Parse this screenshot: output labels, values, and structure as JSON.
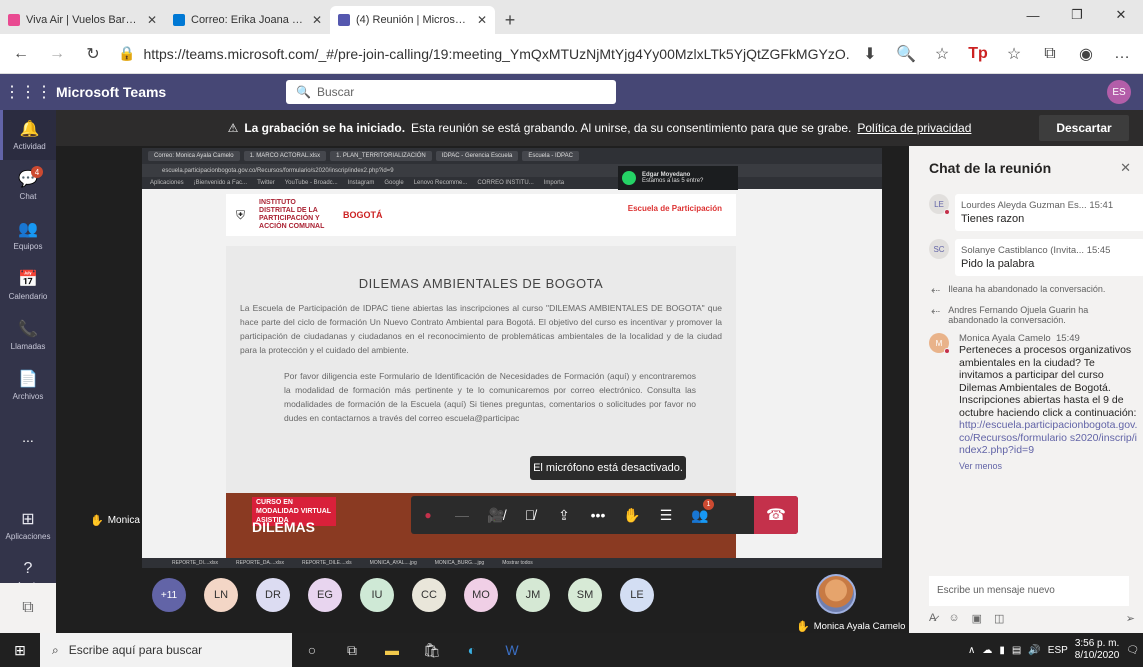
{
  "browser": {
    "tabs": [
      {
        "title": "Viva Air | Vuelos Baratos a Destin",
        "fav": "#e94a91",
        "active": false
      },
      {
        "title": "Correo: Erika Joana Velez Saldarr",
        "fav": "#0078d4",
        "active": false
      },
      {
        "title": "(4) Reunión | Microsoft Tear",
        "fav": "#5558af",
        "active": true
      }
    ],
    "url": "https://teams.microsoft.com/_#/pre-join-calling/19:meeting_YmQxMTUzNjMtYjg4Yy00MzlxLTk5YjQtZGFkMGYzO..."
  },
  "teams": {
    "app_name": "Microsoft Teams",
    "search_placeholder": "Buscar",
    "user_initials": "ES",
    "rail": [
      {
        "label": "Actividad",
        "icon": "bell-icon",
        "glyph": "🔔",
        "badge": ""
      },
      {
        "label": "Chat",
        "icon": "chat-icon",
        "glyph": "💬",
        "badge": "4"
      },
      {
        "label": "Equipos",
        "icon": "teams-icon",
        "glyph": "👥",
        "badge": ""
      },
      {
        "label": "Calendario",
        "icon": "calendar-icon",
        "glyph": "📅",
        "badge": ""
      },
      {
        "label": "Llamadas",
        "icon": "phone-icon",
        "glyph": "📞",
        "badge": ""
      },
      {
        "label": "Archivos",
        "icon": "files-icon",
        "glyph": "📄",
        "badge": ""
      },
      {
        "label": "...",
        "icon": "more-icon",
        "glyph": "",
        "badge": ""
      }
    ],
    "rail_bottom": [
      {
        "label": "Aplicaciones",
        "icon": "apps-icon",
        "glyph": "⊞"
      },
      {
        "label": "Ayuda",
        "icon": "help-icon",
        "glyph": "?"
      }
    ]
  },
  "meeting": {
    "banner_bold": "La grabación se ha iniciado.",
    "banner_text": "Esta reunión se está grabando. Al unirse, da su consentimiento para que se grabe.",
    "banner_link": "Política de privacidad",
    "dismiss": "Descartar",
    "tooltip": "El micrófono está desactivado.",
    "speaker_name": "Monica Ayala Camelo",
    "self_name": "Monica Ayala Camelo",
    "participant_count_badge": "1",
    "participants": [
      {
        "initials": "+11",
        "color": "#6264a7"
      },
      {
        "initials": "LN",
        "color": "#f3d6c6"
      },
      {
        "initials": "DR",
        "color": "#dcdcf2"
      },
      {
        "initials": "EG",
        "color": "#e8d5ef"
      },
      {
        "initials": "IU",
        "color": "#cfe9d6"
      },
      {
        "initials": "CC",
        "color": "#e9e6da"
      },
      {
        "initials": "MO",
        "color": "#f0cfe6"
      },
      {
        "initials": "JM",
        "color": "#d5e8d4"
      },
      {
        "initials": "SM",
        "color": "#d7ead6"
      },
      {
        "initials": "LE",
        "color": "#d3def3"
      }
    ]
  },
  "shared_screen": {
    "tabs": [
      "Correo: Monica Ayala Camelo",
      "1. MARCO ACTORAL.xlsx",
      "1. PLAN_TERRITORIALIZACIÓN",
      "IDPAC - Gerencia Escuela",
      "Escuela - IDPAC"
    ],
    "address": "escuela.participacionbogota.gov.co/Recursos/formulario/s2020/inscrip/index2.php?id=9",
    "bookmarks": [
      "Aplicaciones",
      "¡Bienvenido a Fac...",
      "Twitter",
      "YouTube - Broadc...",
      "Instagram",
      "Google",
      "Lenovo Recomme...",
      "CORREO INSTITU...",
      "Importa"
    ],
    "whatsapp_name": "Edgar Moyedano",
    "whatsapp_msg": "Estamos a las 5 entre?",
    "logo_left": "INSTITUTO DISTRITAL DE LA PARTICIPACIÓN Y ACCIÓN COMUNAL",
    "logo_bogota": "BOGOTÁ",
    "logo_right": "Escuela de Participación",
    "title": "DILEMAS AMBIENTALES DE BOGOTA",
    "para1": "La Escuela de Participación de IDPAC tiene abiertas las inscripciones al curso \"DILEMAS AMBIENTALES DE BOGOTA\" que hace parte del ciclo de formación Un Nuevo Contrato Ambiental para Bogotá. El objetivo del curso es incentivar y promover la participación de ciudadanas y ciudadanos en el reconocimiento de problemáticas ambientales de la localidad y de la ciudad para la protección y el cuidado del ambiente.",
    "para2": "Por favor diligencia este Formulario de Identificación de Necesidades de Formación (aquí) y encontraremos la modalidad de formación más pertinente y te lo comunicaremos por correo electrónico. Consulta las modalidades de formación de la Escuela (aquí) Si tienes preguntas, comentarios o solicitudes por favor no dudes en contactarnos a través del correo escuela@participac",
    "promo_tag": "CURSO EN MODALIDAD VIRTUAL ASISTIDA",
    "promo_title": "DILEMAS",
    "downloads": [
      "REPORTE_DI....xlsx",
      "REPORTE_DA....xlsx",
      "REPORTE_DILE....xls",
      "MONICA_AYAL....jpg",
      "MONICA_BURG....jpg",
      "Mostrar todos"
    ]
  },
  "chat": {
    "title": "Chat de la reunión",
    "messages": [
      {
        "initials": "LE",
        "name": "Lourdes Aleyda Guzman Es...",
        "time": "15:41",
        "text": "Tienes razon"
      },
      {
        "initials": "SC",
        "name": "Solanye Castiblanco (Invita...",
        "time": "15:45",
        "text": "Pido la palabra"
      }
    ],
    "system": [
      "Ileana ha abandonado la conversación.",
      "Andres Fernando Ojuela Guarin ha abandonado la conversación."
    ],
    "monica": {
      "name": "Monica Ayala Camelo",
      "time": "15:49",
      "text": "Perteneces a procesos organizativos ambientales en la ciudad? Te invitamos a participar del curso Dilemas Ambientales de Bogotá. Inscripciones abiertas hasta el 9 de octubre haciendo click a continuación:",
      "link": "http://escuela.participacionbogota.gov.co/Recursos/formulario s2020/inscrip/index2.php?id=9",
      "see_less": "Ver menos"
    },
    "compose_placeholder": "Escribe un mensaje nuevo"
  },
  "taskbar": {
    "search": "Escribe aquí para buscar",
    "lang": "ESP",
    "time": "3:56 p. m.",
    "date": "8/10/2020"
  }
}
